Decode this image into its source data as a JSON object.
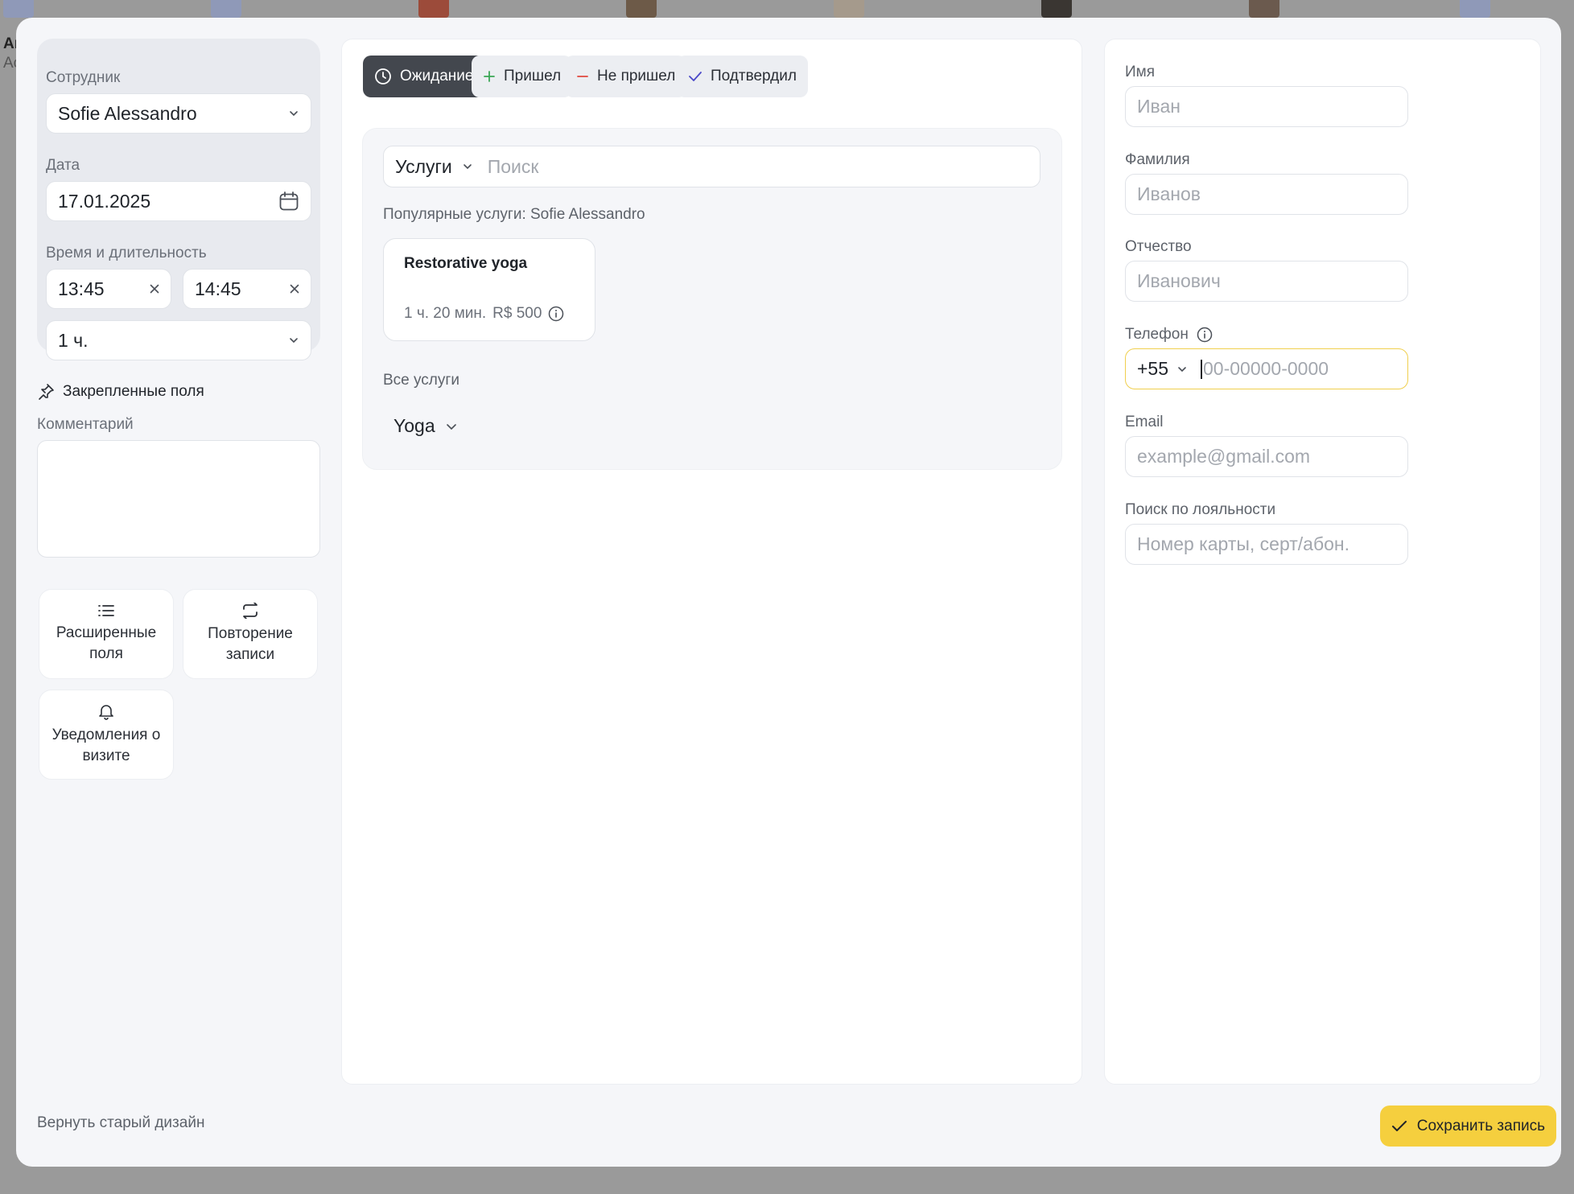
{
  "background": {
    "text_top": "Ar",
    "text_bottom": "Ac"
  },
  "left": {
    "employee_label": "Сотрудник",
    "employee_value": "Sofie Alessandro",
    "date_label": "Дата",
    "date_value": "17.01.2025",
    "time_label": "Время и длительность",
    "time_start": "13:45",
    "time_end": "14:45",
    "duration": "1 ч.",
    "pinned_label": "Закрепленные поля",
    "comment_label": "Комментарий",
    "tiles": [
      {
        "label": "Расширенные поля",
        "icon": "list-icon"
      },
      {
        "label": "Повторение записи",
        "icon": "repeat-icon"
      },
      {
        "label": "Уведомления о визите",
        "icon": "bell-icon"
      }
    ],
    "old_design_link": "Вернуть старый дизайн"
  },
  "status": {
    "buttons": [
      {
        "label": "Ожидание",
        "icon": "clock-icon",
        "active": true
      },
      {
        "label": "Пришел",
        "icon": "plus-icon",
        "color": "#3aa655"
      },
      {
        "label": "Не пришел",
        "icon": "minus-icon",
        "color": "#e0473e"
      },
      {
        "label": "Подтвердил",
        "icon": "check-icon",
        "color": "#4a48c8"
      }
    ]
  },
  "services": {
    "dropdown_label": "Услуги",
    "search_placeholder": "Поиск",
    "popular_title": "Популярные услуги: Sofie Alessandro",
    "popular": [
      {
        "name": "Restorative yoga",
        "duration": "1 ч. 20 мин.",
        "price": "R$ 500"
      }
    ],
    "all_title": "Все услуги",
    "category": "Yoga"
  },
  "client": {
    "first_name_label": "Имя",
    "first_name_placeholder": "Иван",
    "last_name_label": "Фамилия",
    "last_name_placeholder": "Иванов",
    "middle_name_label": "Отчество",
    "middle_name_placeholder": "Иванович",
    "phone_label": "Телефон",
    "phone_code": "+55",
    "phone_placeholder": "00-00000-0000",
    "email_label": "Email",
    "email_placeholder": "example@gmail.com",
    "loyalty_label": "Поиск по лояльности",
    "loyalty_placeholder": "Номер карты, серт/абон."
  },
  "actions": {
    "save_label": "Сохранить запись"
  },
  "colors": {
    "accent": "#f5cf3e",
    "active_status": "#43474e",
    "phone_focus": "#f0cf4e"
  }
}
